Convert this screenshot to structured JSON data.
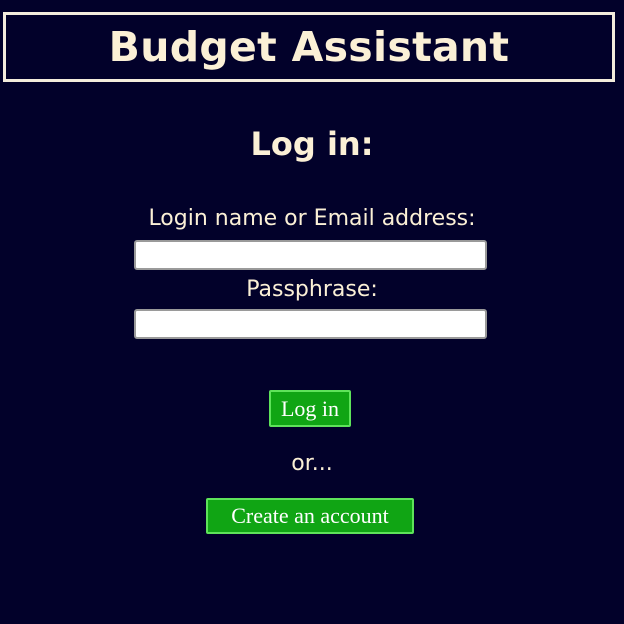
{
  "header": {
    "title": "Budget Assistant"
  },
  "login": {
    "heading": "Log in:",
    "login_label": "Login name or Email address:",
    "login_value": "",
    "passphrase_label": "Passphrase:",
    "passphrase_value": "",
    "login_button": "Log in",
    "or_text": "or...",
    "create_button": "Create an account"
  },
  "colors": {
    "background": "#02012a",
    "text": "#fbf0d6",
    "header_border": "#f3ecdc",
    "button_fill": "#10a514",
    "button_border": "#5ee35a"
  }
}
